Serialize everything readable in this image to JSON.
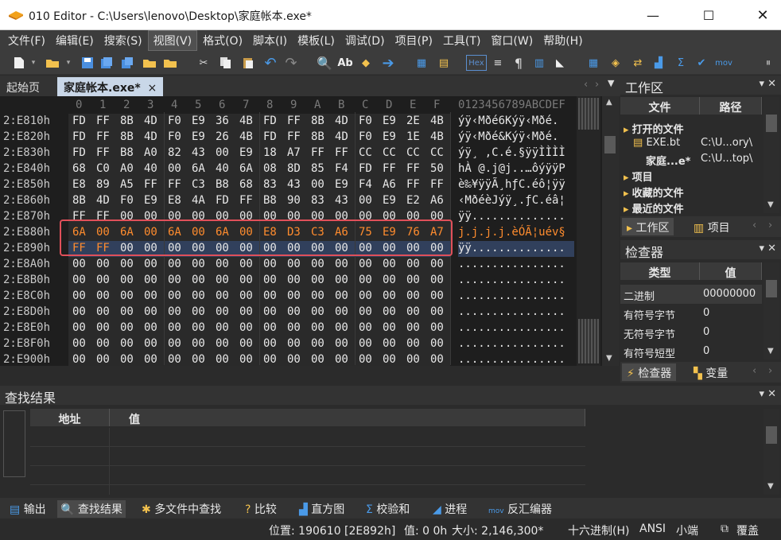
{
  "window": {
    "title": "010 Editor - C:\\Users\\lenovo\\Desktop\\家庭帐本.exe*"
  },
  "menu": [
    "文件(F)",
    "编辑(E)",
    "搜索(S)",
    "视图(V)",
    "格式(O)",
    "脚本(I)",
    "模板(L)",
    "调试(D)",
    "项目(P)",
    "工具(T)",
    "窗口(W)",
    "帮助(H)"
  ],
  "toolbar": {
    "hex_label": "Hex",
    "mov_label": "mov"
  },
  "tabs": {
    "start": "起始页",
    "file": "家庭帐本.exe*",
    "close": "×"
  },
  "hex": {
    "columns": [
      "0",
      "1",
      "2",
      "3",
      "4",
      "5",
      "6",
      "7",
      "8",
      "9",
      "A",
      "B",
      "C",
      "D",
      "E",
      "F"
    ],
    "ascii_header": "0123456789ABCDEF",
    "rows": [
      {
        "addr": "2:E810h",
        "bytes": [
          "FD",
          "FF",
          "8B",
          "4D",
          "F0",
          "E9",
          "36",
          "4B",
          "FD",
          "FF",
          "8B",
          "4D",
          "F0",
          "E9",
          "2E",
          "4B"
        ],
        "ascii": "ýÿ‹Mðé6Kýÿ‹Mðé."
      },
      {
        "addr": "2:E820h",
        "bytes": [
          "FD",
          "FF",
          "8B",
          "4D",
          "F0",
          "E9",
          "26",
          "4B",
          "FD",
          "FF",
          "8B",
          "4D",
          "F0",
          "E9",
          "1E",
          "4B"
        ],
        "ascii": "ýÿ‹Mðé&Kýÿ‹Mðé."
      },
      {
        "addr": "2:E830h",
        "bytes": [
          "FD",
          "FF",
          "B8",
          "A0",
          "82",
          "43",
          "00",
          "E9",
          "18",
          "A7",
          "FF",
          "FF",
          "CC",
          "CC",
          "CC",
          "CC"
        ],
        "ascii": "ýÿ¸ ‚C.é.§ÿÿÌÌÌÌ"
      },
      {
        "addr": "2:E840h",
        "bytes": [
          "68",
          "C0",
          "A0",
          "40",
          "00",
          "6A",
          "40",
          "6A",
          "08",
          "8D",
          "85",
          "F4",
          "FD",
          "FF",
          "FF",
          "50"
        ],
        "ascii": "hÀ @.j@j..…ôýÿÿP"
      },
      {
        "addr": "2:E850h",
        "bytes": [
          "E8",
          "89",
          "A5",
          "FF",
          "FF",
          "C3",
          "B8",
          "68",
          "83",
          "43",
          "00",
          "E9",
          "F4",
          "A6",
          "FF",
          "FF"
        ],
        "ascii": "è‰¥ÿÿÃ¸hƒC.éô¦ÿÿ"
      },
      {
        "addr": "2:E860h",
        "bytes": [
          "8B",
          "4D",
          "F0",
          "E9",
          "E8",
          "4A",
          "FD",
          "FF",
          "B8",
          "90",
          "83",
          "43",
          "00",
          "E9",
          "E2",
          "A6"
        ],
        "ascii": "‹MðéèJýÿ¸.ƒC.éâ¦"
      },
      {
        "addr": "2:E870h",
        "bytes": [
          "FF",
          "FF",
          "00",
          "00",
          "00",
          "00",
          "00",
          "00",
          "00",
          "00",
          "00",
          "00",
          "00",
          "00",
          "00",
          "00"
        ],
        "ascii": "ÿÿ.............."
      },
      {
        "addr": "2:E880h",
        "bytes": [
          "6A",
          "00",
          "6A",
          "00",
          "6A",
          "00",
          "6A",
          "00",
          "E8",
          "D3",
          "C3",
          "A6",
          "75",
          "E9",
          "76",
          "A7"
        ],
        "ascii": "j.j.j.j.èÓÃ¦uév§"
      },
      {
        "addr": "2:E890h",
        "bytes": [
          "FF",
          "FF",
          "00",
          "00",
          "00",
          "00",
          "00",
          "00",
          "00",
          "00",
          "00",
          "00",
          "00",
          "00",
          "00",
          "00"
        ],
        "ascii": "ÿÿ.............."
      },
      {
        "addr": "2:E8A0h",
        "bytes": [
          "00",
          "00",
          "00",
          "00",
          "00",
          "00",
          "00",
          "00",
          "00",
          "00",
          "00",
          "00",
          "00",
          "00",
          "00",
          "00"
        ],
        "ascii": "................"
      },
      {
        "addr": "2:E8B0h",
        "bytes": [
          "00",
          "00",
          "00",
          "00",
          "00",
          "00",
          "00",
          "00",
          "00",
          "00",
          "00",
          "00",
          "00",
          "00",
          "00",
          "00"
        ],
        "ascii": "................"
      },
      {
        "addr": "2:E8C0h",
        "bytes": [
          "00",
          "00",
          "00",
          "00",
          "00",
          "00",
          "00",
          "00",
          "00",
          "00",
          "00",
          "00",
          "00",
          "00",
          "00",
          "00"
        ],
        "ascii": "................"
      },
      {
        "addr": "2:E8D0h",
        "bytes": [
          "00",
          "00",
          "00",
          "00",
          "00",
          "00",
          "00",
          "00",
          "00",
          "00",
          "00",
          "00",
          "00",
          "00",
          "00",
          "00"
        ],
        "ascii": "................"
      },
      {
        "addr": "2:E8E0h",
        "bytes": [
          "00",
          "00",
          "00",
          "00",
          "00",
          "00",
          "00",
          "00",
          "00",
          "00",
          "00",
          "00",
          "00",
          "00",
          "00",
          "00"
        ],
        "ascii": "................"
      },
      {
        "addr": "2:E8F0h",
        "bytes": [
          "00",
          "00",
          "00",
          "00",
          "00",
          "00",
          "00",
          "00",
          "00",
          "00",
          "00",
          "00",
          "00",
          "00",
          "00",
          "00"
        ],
        "ascii": "................"
      },
      {
        "addr": "2:E900h",
        "bytes": [
          "00",
          "00",
          "00",
          "00",
          "00",
          "00",
          "00",
          "00",
          "00",
          "00",
          "00",
          "00",
          "00",
          "00",
          "00",
          "00"
        ],
        "ascii": "................"
      }
    ]
  },
  "workspace": {
    "title": "工作区",
    "col_file": "文件",
    "col_path": "路径",
    "open_files": "打开的文件",
    "file1": "EXE.bt",
    "file1_path": "C:\\U...ory\\",
    "file2": "家庭...e*",
    "file2_path": "C:\\U...top\\",
    "projects": "项目",
    "favorites": "收藏的文件",
    "recent": "最近的文件",
    "tab_workspace": "工作区",
    "tab_project": "项目"
  },
  "inspector": {
    "title": "检查器",
    "col_type": "类型",
    "col_value": "值",
    "rows": [
      {
        "k": "二进制",
        "v": "00000000"
      },
      {
        "k": "有符号字节",
        "v": "0"
      },
      {
        "k": "无符号字节",
        "v": "0"
      },
      {
        "k": "有符号短型",
        "v": "0"
      }
    ],
    "tab_inspector": "检查器",
    "tab_vars": "变量"
  },
  "find": {
    "title": "查找结果",
    "col_addr": "地址",
    "col_value": "值"
  },
  "bottom_tabs": [
    "输出",
    "查找结果",
    "多文件中查找",
    "比较",
    "直方图",
    "校验和",
    "进程",
    "反汇编器"
  ],
  "status": {
    "position": "位置: 190610 [2E892h]",
    "value": "值: 0 0h",
    "size": "大小: 2,146,300*",
    "mode": "十六进制(H)",
    "encoding": "ANSI",
    "endian": "小端",
    "overwrite": "覆盖"
  },
  "colors": {
    "accent": "#ff8c2e",
    "highlight": "#e0505a",
    "selection": "#31405c"
  }
}
